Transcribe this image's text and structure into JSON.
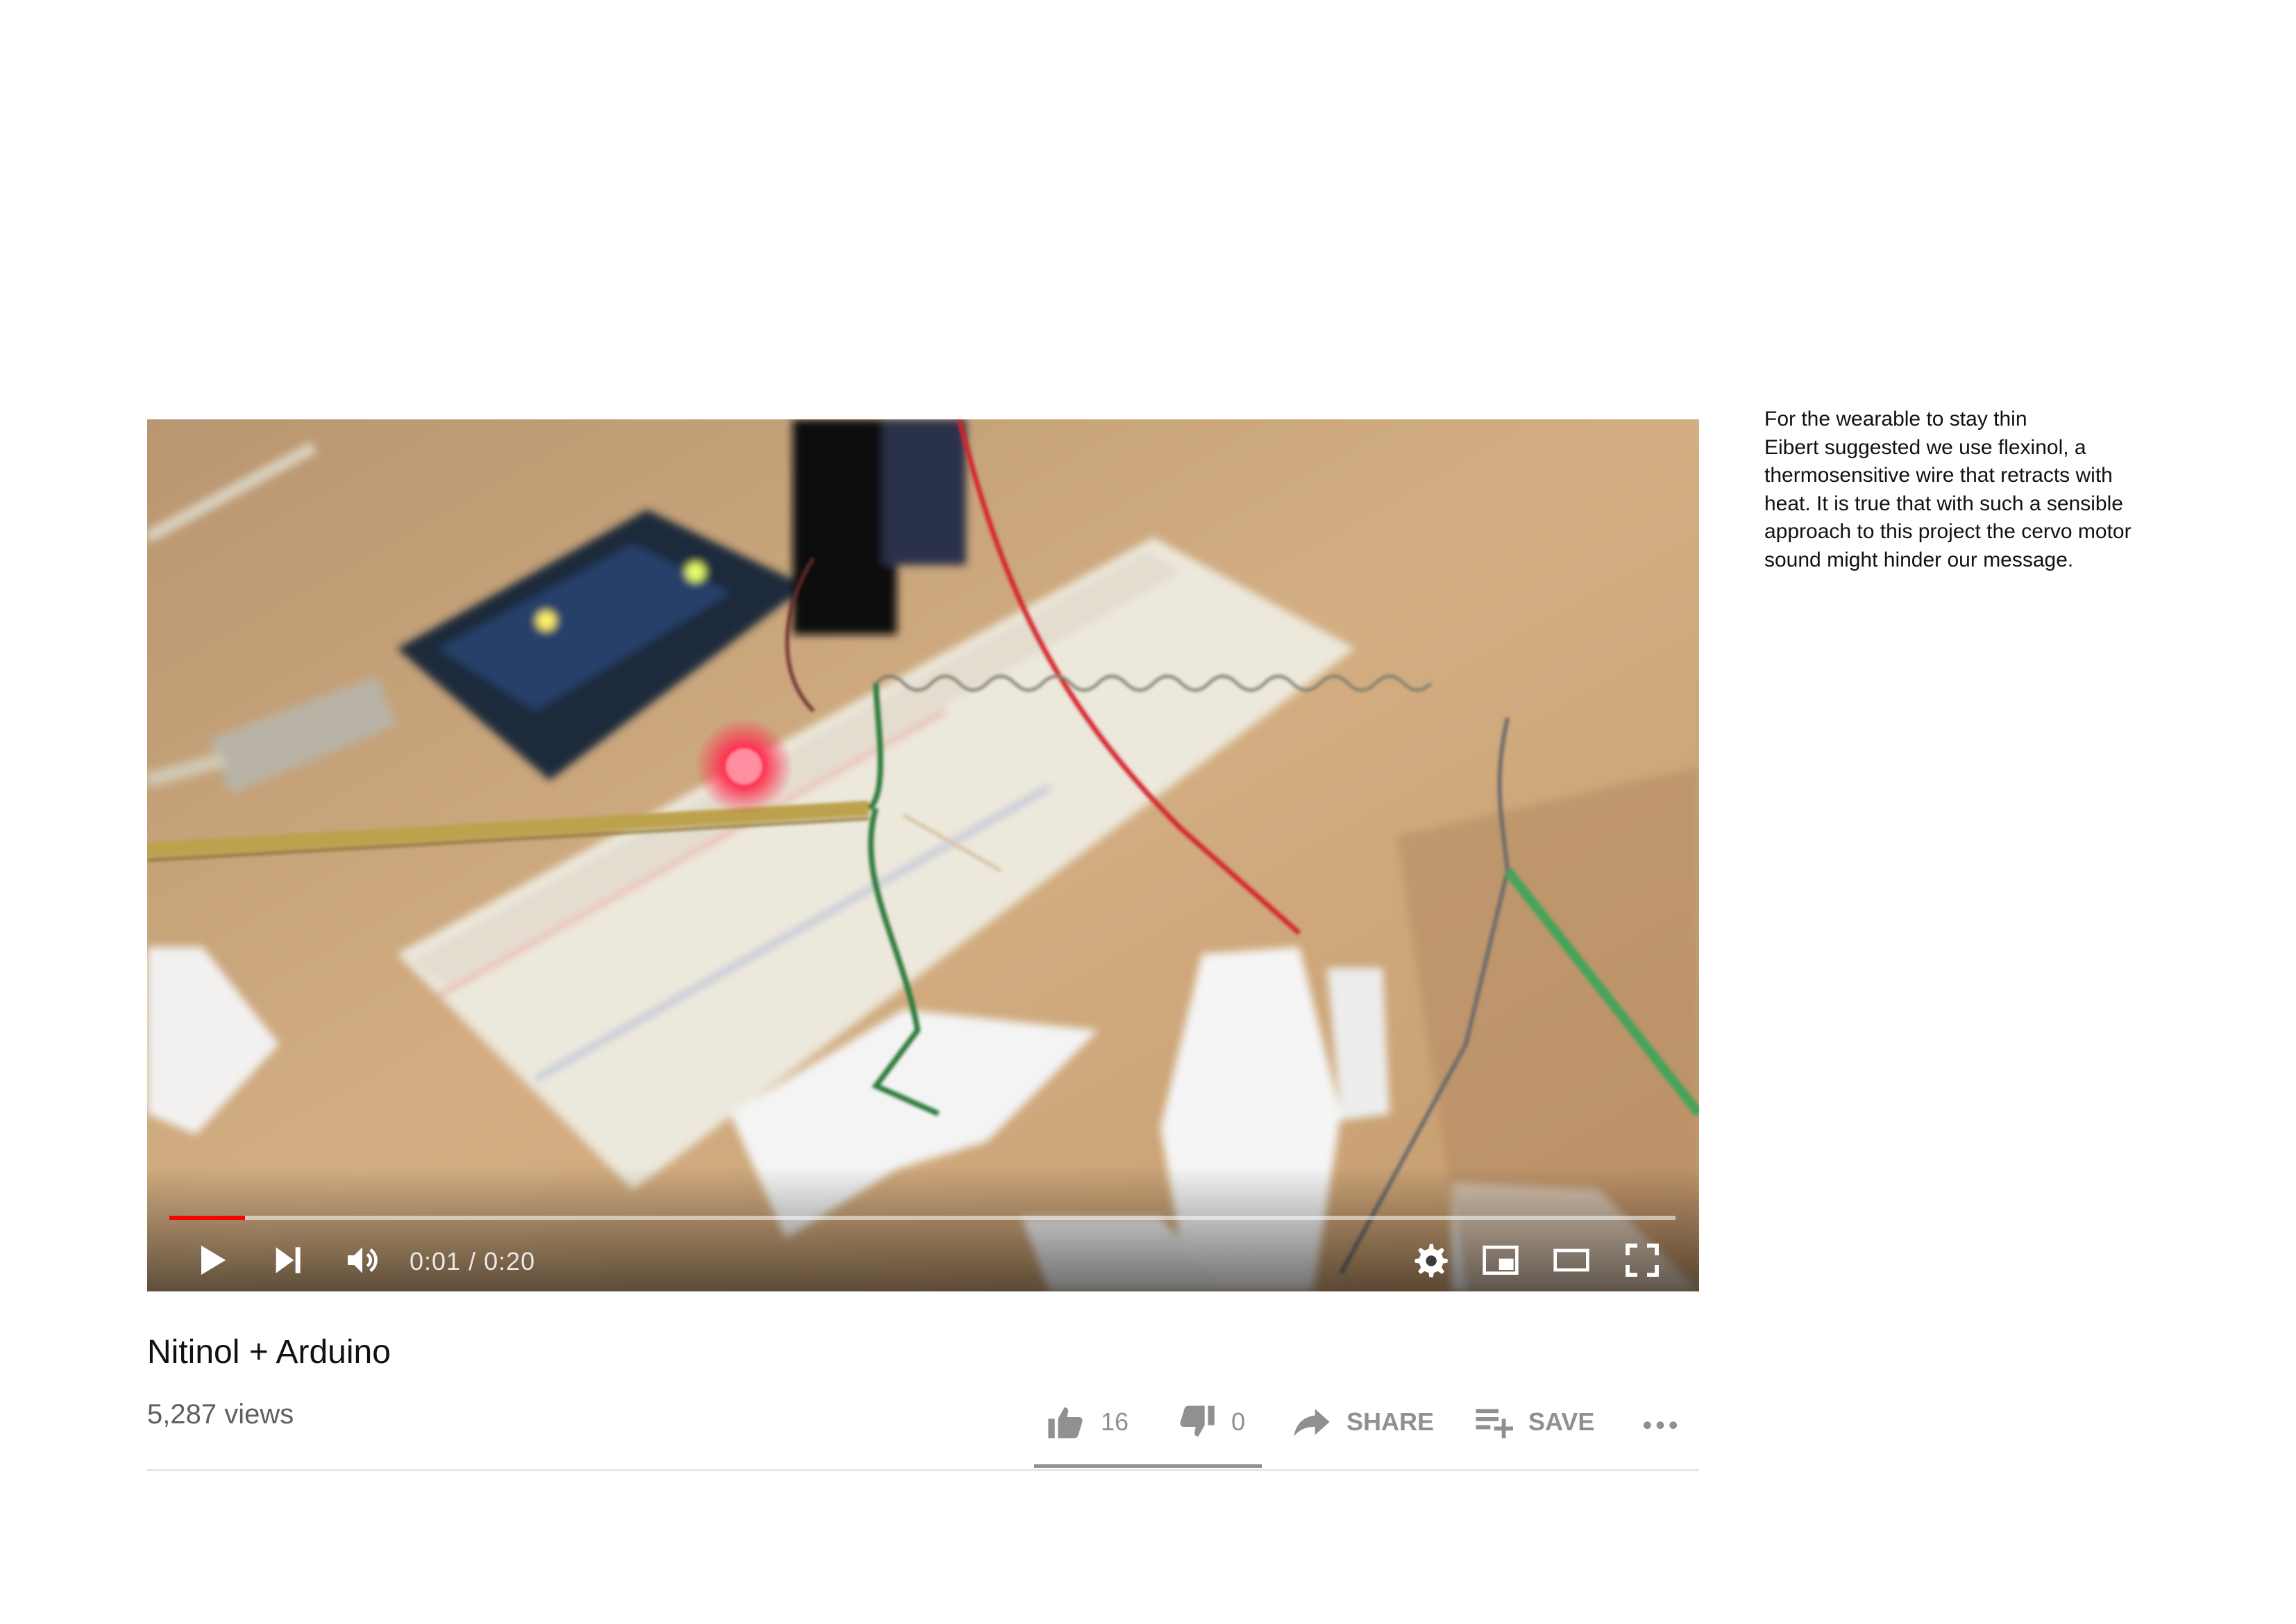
{
  "video": {
    "current_time": "0:01",
    "duration": "0:20",
    "time_display": "0:01 / 0:20",
    "progress_fraction": 0.05
  },
  "title": "Nitinol + Arduino",
  "views": "5,287 views",
  "actions": {
    "like_count": "16",
    "dislike_count": "0",
    "share_label": "SHARE",
    "save_label": "SAVE"
  },
  "note": "For the wearable to stay thin\nEibert suggested we use flexinol, a\nthermosensitive wire that retracts with\nheat. It is true that with such a sensible\napproach to this project the cervo motor\nsound might hinder our message.",
  "icons": {
    "play": "play-icon",
    "next": "next-icon",
    "volume": "volume-icon",
    "settings": "gear-icon",
    "miniplayer": "miniplayer-icon",
    "theater": "theater-icon",
    "fullscreen": "fullscreen-icon",
    "like": "thumbs-up-icon",
    "dislike": "thumbs-down-icon",
    "share": "share-arrow-icon",
    "save": "playlist-add-icon",
    "more": "more-dots-icon"
  },
  "colors": {
    "progress": "#ff0000",
    "secondary_text": "#909090"
  }
}
